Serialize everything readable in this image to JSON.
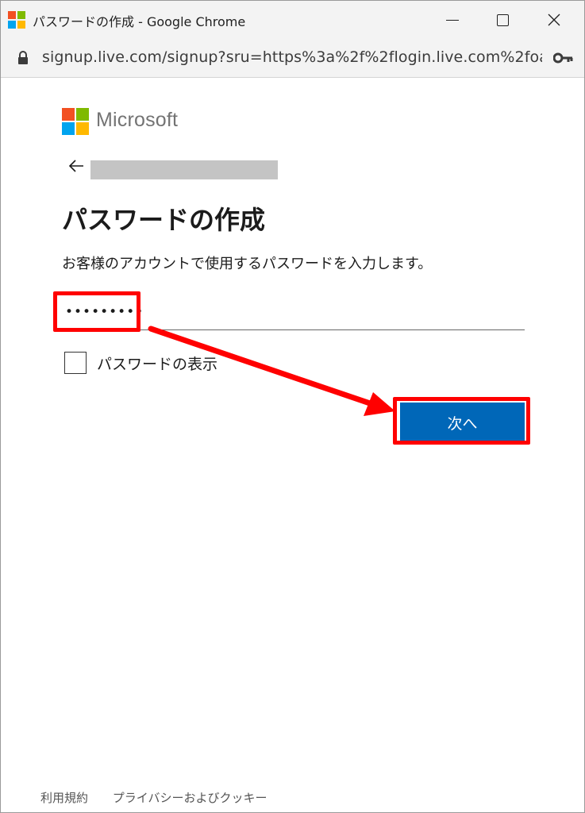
{
  "window": {
    "title": "パスワードの作成 - Google Chrome",
    "url": "signup.live.com/signup?sru=https%3a%2f%2flogin.live.com%2foa…"
  },
  "brand": {
    "wordmark": "Microsoft",
    "colors": {
      "red": "#f25022",
      "green": "#7fba00",
      "blue": "#00a4ef",
      "yellow": "#ffb900"
    }
  },
  "form": {
    "title": "パスワードの作成",
    "instruction": "お客様のアカウントで使用するパスワードを入力します。",
    "password_value": "•••••••••",
    "show_password_label": "パスワードの表示",
    "next_button_label": "次へ"
  },
  "footer": {
    "terms": "利用規約",
    "privacy": "プライバシーおよびクッキー"
  },
  "annotations": {
    "color": "#ff0000"
  },
  "accent": "#0067b8"
}
